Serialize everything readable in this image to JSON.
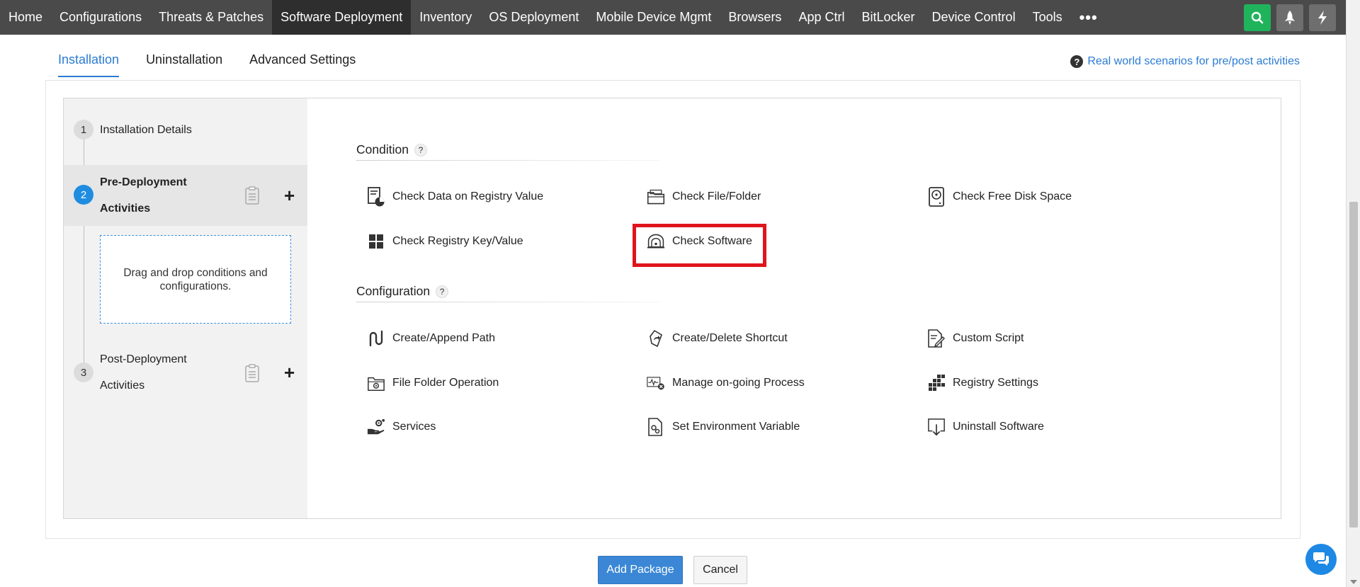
{
  "nav": {
    "items": [
      "Home",
      "Configurations",
      "Threats & Patches",
      "Software Deployment",
      "Inventory",
      "OS Deployment",
      "Mobile Device Mgmt",
      "Browsers",
      "App Ctrl",
      "BitLocker",
      "Device Control",
      "Tools"
    ],
    "active_index": 3,
    "more": "•••",
    "right_icons": [
      "search-icon",
      "rocket-icon",
      "lightning-icon"
    ]
  },
  "tabs": {
    "items": [
      "Installation",
      "Uninstallation",
      "Advanced Settings"
    ],
    "active": "Installation"
  },
  "help_link": "Real world scenarios for pre/post activities",
  "steps": [
    {
      "num": "1",
      "label": "Installation Details"
    },
    {
      "num": "2",
      "label_line1": "Pre-Deployment",
      "label_line2": "Activities"
    },
    {
      "num": "3",
      "label_line1": "Post-Deployment",
      "label_line2": "Activities"
    }
  ],
  "dropzone_text": "Drag and drop conditions and configurations.",
  "condition": {
    "title": "Condition",
    "help": "?",
    "items": [
      "Check Data on Registry Value",
      "Check File/Folder",
      "Check Free Disk Space",
      "Check Registry Key/Value",
      "Check Software"
    ]
  },
  "configuration": {
    "title": "Configuration",
    "help": "?",
    "items": [
      "Create/Append Path",
      "Create/Delete Shortcut",
      "Custom Script",
      "File Folder Operation",
      "Manage on-going Process",
      "Registry Settings",
      "Services",
      "Set Environment Variable",
      "Uninstall Software"
    ]
  },
  "buttons": {
    "add_package": "Add Package",
    "cancel": "Cancel"
  },
  "colors": {
    "accent": "#2b7bd3",
    "highlight": "#e0141c",
    "nav_bg": "#4a4a4a",
    "search_btn": "#1fb35b"
  }
}
